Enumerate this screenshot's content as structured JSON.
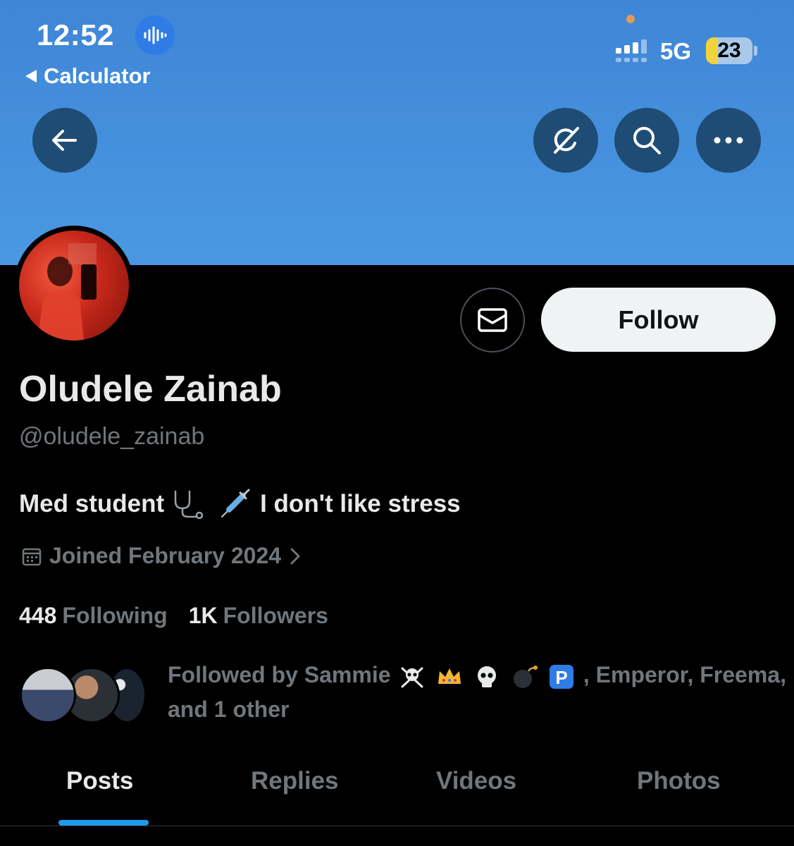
{
  "status_bar": {
    "time": "12:52",
    "back_app": "Calculator",
    "network": "5G",
    "battery": "23"
  },
  "header": {
    "icons": [
      "back-arrow-icon",
      "grok-icon",
      "search-icon",
      "more-icon"
    ]
  },
  "profile": {
    "display_name": "Oludele Zainab",
    "handle": "@oludele_zainab",
    "bio_part1": "Med student",
    "bio_part2": "I don't like stress",
    "joined": "Joined February 2024",
    "following_count": "448",
    "following_label": "Following",
    "followers_count": "1K",
    "followers_label": "Followers",
    "followed_by_prefix": "Followed by Sammie",
    "followed_by_suffix": ", Emperor, Freema,",
    "followed_by_line2": "and 1 other"
  },
  "actions": {
    "follow_label": "Follow"
  },
  "tabs": [
    {
      "label": "Posts",
      "active": true
    },
    {
      "label": "Replies",
      "active": false
    },
    {
      "label": "Videos",
      "active": false
    },
    {
      "label": "Photos",
      "active": false
    }
  ],
  "colors": {
    "banner": "#4a98e3",
    "accent": "#1d9bf0",
    "muted_text": "#71767b",
    "follow_bg": "#eff3f4"
  }
}
